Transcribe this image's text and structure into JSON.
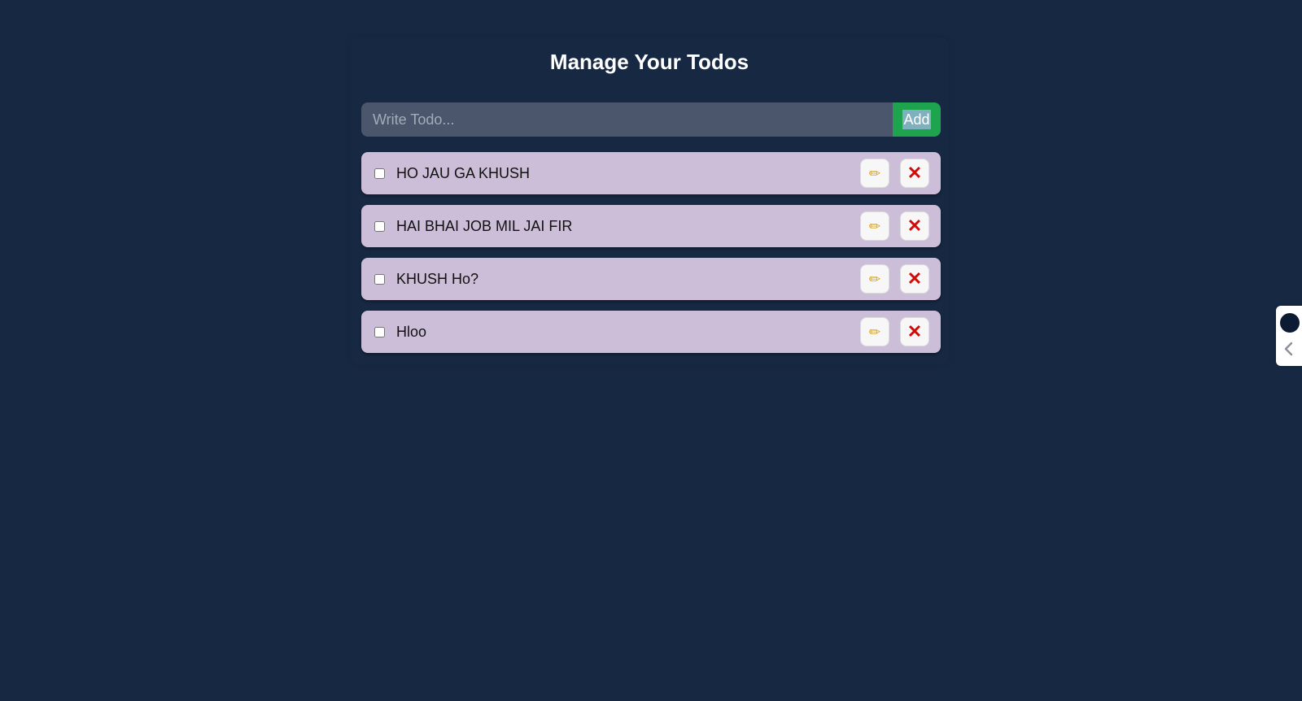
{
  "page": {
    "title": "Manage Your Todos"
  },
  "form": {
    "placeholder": "Write Todo...",
    "add_label": "Add"
  },
  "todos": [
    {
      "text": "HO JAU GA KHUSH",
      "completed": false
    },
    {
      "text": "HAI BHAI JOB MIL JAI FIR",
      "completed": false
    },
    {
      "text": "KHUSH Ho?",
      "completed": false
    },
    {
      "text": "Hloo",
      "completed": false
    }
  ],
  "icons": {
    "edit": "pencil-icon",
    "delete": "cross-icon",
    "widget_logo": "extension-logo-icon",
    "widget_toggle": "chevron-left-icon"
  },
  "colors": {
    "background": "#172842",
    "input_bg": "#4b566c",
    "add_button": "#1ea34f",
    "todo_item_bg": "#ccbed8",
    "delete_icon": "#d10a0a"
  }
}
